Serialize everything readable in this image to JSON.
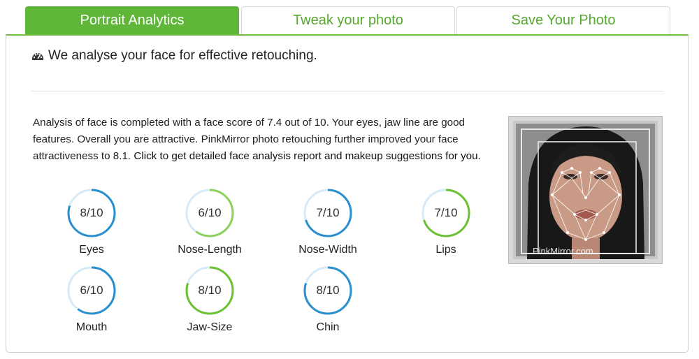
{
  "tabs": [
    {
      "label": "Portrait Analytics",
      "active": true
    },
    {
      "label": "Tweak your photo",
      "active": false
    },
    {
      "label": "Save Your Photo",
      "active": false
    }
  ],
  "panel": {
    "heading_icon": "dashboard-icon",
    "heading": "We analyse your face for effective retouching.",
    "analysis_text": "Analysis of face is completed with a face score of 7.4 out of 10. Your eyes, jaw line are good features. Overall you are attractive. PinkMirror photo retouching further improved your face attractiveness to 8.1.",
    "analysis_link": "Click to get detailed face analysis report and makeup suggestions for you."
  },
  "colors": {
    "accent_green": "#5fb639",
    "ring_blue": "#2a8fcf",
    "ring_green": "#6cc033"
  },
  "metrics": [
    {
      "score": "8/10",
      "label": "Eyes",
      "fraction": 0.8,
      "color": "#2a8fcf"
    },
    {
      "score": "6/10",
      "label": "Nose-Length",
      "fraction": 0.6,
      "color": "#8fd05a"
    },
    {
      "score": "7/10",
      "label": "Nose-Width",
      "fraction": 0.7,
      "color": "#2a8fcf"
    },
    {
      "score": "7/10",
      "label": "Lips",
      "fraction": 0.7,
      "color": "#6cc033"
    },
    {
      "score": "6/10",
      "label": "Mouth",
      "fraction": 0.6,
      "color": "#2a8fcf"
    },
    {
      "score": "8/10",
      "label": "Jaw-Size",
      "fraction": 0.8,
      "color": "#6cc033"
    },
    {
      "score": "8/10",
      "label": "Chin",
      "fraction": 0.8,
      "color": "#2a8fcf"
    }
  ],
  "photo": {
    "watermark": "PinkMirror.com"
  }
}
